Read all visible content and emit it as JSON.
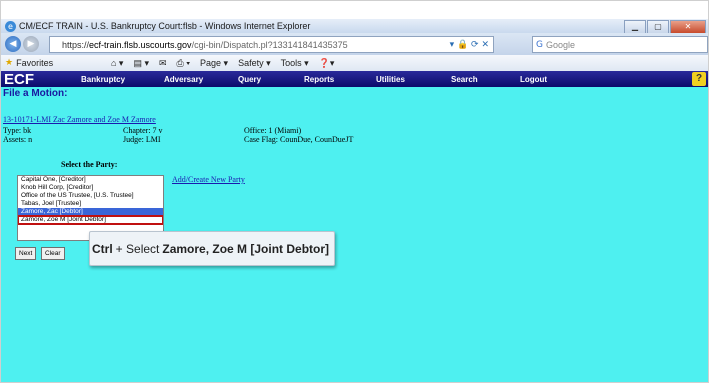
{
  "browser": {
    "window_title": "CM/ECF TRAIN - U.S. Bankruptcy Court:flsb - Windows Internet Explorer",
    "url_scheme": "https://",
    "url_host": "ecf-train.flsb.uscourts.gov",
    "url_path": "/cgi-bin/Dispatch.pl?133141841435375",
    "search_placeholder": "Google",
    "favorites_label": "Favorites",
    "toolbar": {
      "page": "Page ▾",
      "safety": "Safety ▾",
      "tools": "Tools ▾",
      "help": "❓▾"
    }
  },
  "ecf": {
    "logo": "ECF",
    "menu": [
      "Bankruptcy",
      "Adversary",
      "Query",
      "Reports",
      "Utilities",
      "Search",
      "Logout"
    ],
    "help_icon": "?"
  },
  "form": {
    "title": "File a Motion:",
    "case_link": "13-10171-LMI Zac Zamore and Zoe M Zamore",
    "type": "Type: bk",
    "chapter": "Chapter: 7 v",
    "office": "Office: 1 (Miami)",
    "assets": "Assets: n",
    "judge": "Judge: LMI",
    "case_flag": "Case Flag: CounDue, CounDueJT",
    "select_party_label": "Select the Party:",
    "parties": [
      "Capital One, [Creditor]",
      "Knob Hill Corp, [Creditor]",
      "Office of the US Trustee, [U.S. Trustee]",
      "Tabas, Joel [Trustee]",
      "Zamore, Zac [Debtor]",
      "Zamore, Zoe M [Joint Debtor]"
    ],
    "add_party_link": "Add/Create New Party",
    "next_button": "Next",
    "clear_button": "Clear"
  },
  "callout": {
    "key": "Ctrl",
    "plus": "+ Select",
    "target": "Zamore, Zoe M [Joint Debtor]"
  }
}
